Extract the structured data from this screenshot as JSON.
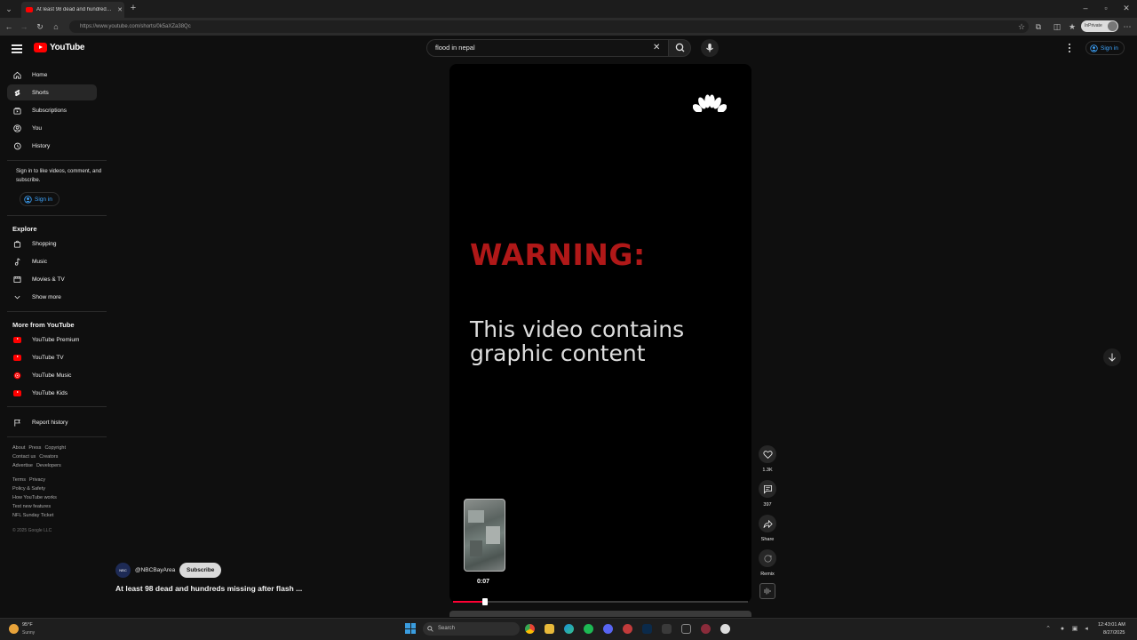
{
  "browser": {
    "tab_title": "At least 98 dead and hundreds m...",
    "url": "https://www.youtube.com/shorts/0k5aXZa38Qc",
    "inprivate_label": "InPrivate"
  },
  "header": {
    "logo_text": "YouTube",
    "search_value": "flood in nepal",
    "sign_in": "Sign in"
  },
  "sidebar": {
    "items": [
      {
        "label": "Home",
        "icon": "home-icon"
      },
      {
        "label": "Shorts",
        "icon": "shorts-icon"
      },
      {
        "label": "Subscriptions",
        "icon": "subscriptions-icon"
      },
      {
        "label": "You",
        "icon": "you-icon"
      },
      {
        "label": "History",
        "icon": "history-icon"
      }
    ],
    "signin_prompt": "Sign in to like videos, comment, and subscribe.",
    "signin_button": "Sign in",
    "explore_heading": "Explore",
    "explore_items": [
      {
        "label": "Shopping",
        "icon": "shopping-icon"
      },
      {
        "label": "Music",
        "icon": "music-icon"
      },
      {
        "label": "Movies & TV",
        "icon": "movies-icon"
      },
      {
        "label": "Show more",
        "icon": "chevron-down-icon"
      }
    ],
    "more_heading": "More from YouTube",
    "more_items": [
      {
        "label": "YouTube Premium"
      },
      {
        "label": "YouTube TV"
      },
      {
        "label": "YouTube Music"
      },
      {
        "label": "YouTube Kids"
      }
    ],
    "report_history": "Report history",
    "footer_row1": [
      "About",
      "Press",
      "Copyright"
    ],
    "footer_row2": [
      "Contact us",
      "Creators"
    ],
    "footer_row3": [
      "Advertise",
      "Developers"
    ],
    "footer_row4": [
      "Terms",
      "Privacy"
    ],
    "footer_row5": "Policy & Safety",
    "footer_row6": "How YouTube works",
    "footer_row7": "Test new features",
    "footer_row8": "NFL Sunday Ticket",
    "copyright": "© 2025 Google LLC"
  },
  "player": {
    "warning_title": "WARNING:",
    "warning_body": "This video contains graphic content",
    "thumb_time": "0:07",
    "progress": 0.11
  },
  "actions": {
    "like_count": "1.3K",
    "comment_count": "397",
    "share_label": "Share",
    "remix_label": "Remix"
  },
  "channel": {
    "avatar_text": "NBC",
    "handle": "@NBCBayArea",
    "subscribe_label": "Subscribe",
    "title": "At least 98 dead and hundreds missing after flash ..."
  },
  "taskbar": {
    "temp": "95°F",
    "weather": "Sunny",
    "search_placeholder": "Search",
    "time": "12:43:01 AM",
    "date": "8/27/2025"
  }
}
